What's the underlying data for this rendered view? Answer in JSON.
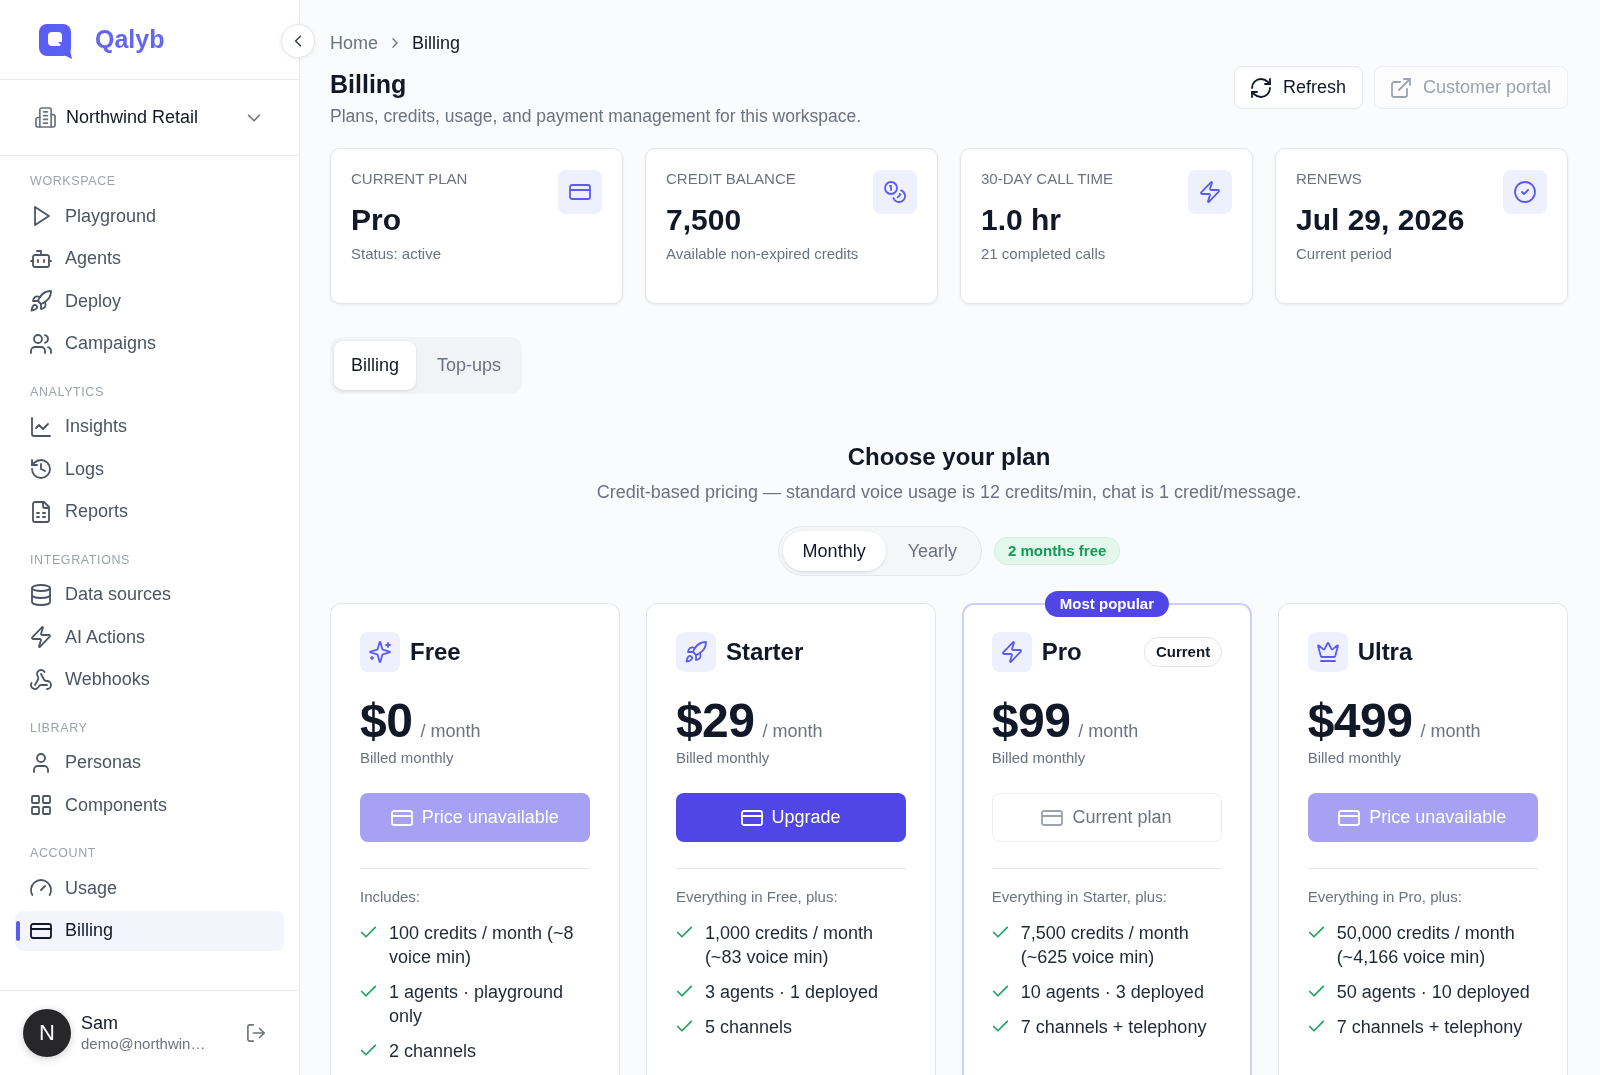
{
  "sidebar": {
    "brand": "Qalyb",
    "workspace": "Northwind Retail",
    "sections": [
      {
        "title": "WORKSPACE",
        "items": [
          {
            "label": "Playground",
            "selected": false
          },
          {
            "label": "Agents",
            "selected": false
          },
          {
            "label": "Deploy",
            "selected": false
          },
          {
            "label": "Campaigns",
            "selected": false
          }
        ]
      },
      {
        "title": "ANALYTICS",
        "items": [
          {
            "label": "Insights",
            "selected": false
          },
          {
            "label": "Logs",
            "selected": false
          },
          {
            "label": "Reports",
            "selected": false
          }
        ]
      },
      {
        "title": "INTEGRATIONS",
        "items": [
          {
            "label": "Data sources",
            "selected": false
          },
          {
            "label": "AI Actions",
            "selected": false
          },
          {
            "label": "Webhooks",
            "selected": false
          }
        ]
      },
      {
        "title": "LIBRARY",
        "items": [
          {
            "label": "Personas",
            "selected": false
          },
          {
            "label": "Components",
            "selected": false
          }
        ]
      },
      {
        "title": "ACCOUNT",
        "items": [
          {
            "label": "Usage",
            "selected": false
          },
          {
            "label": "Billing",
            "selected": true
          }
        ]
      }
    ],
    "user": {
      "initial": "N",
      "name": "Sam",
      "email": "demo@northwin…"
    }
  },
  "breadcrumb": [
    {
      "label": "Home",
      "current": false
    },
    {
      "label": "Billing",
      "current": true
    }
  ],
  "header": {
    "title": "Billing",
    "subtitle": "Plans, credits, usage, and payment management for this workspace.",
    "actions": [
      {
        "label": "Refresh",
        "disabled": false
      },
      {
        "label": "Customer portal",
        "disabled": true
      }
    ]
  },
  "stats": [
    {
      "label": "CURRENT PLAN",
      "value": "Pro",
      "caption": "Status: active"
    },
    {
      "label": "CREDIT BALANCE",
      "value": "7,500",
      "caption": "Available non-expired credits"
    },
    {
      "label": "30-DAY CALL TIME",
      "value": "1.0 hr",
      "caption": "21 completed calls"
    },
    {
      "label": "RENEWS",
      "value": "Jul 29, 2026",
      "caption": "Current period"
    }
  ],
  "tabs": [
    {
      "label": "Billing",
      "selected": true
    },
    {
      "label": "Top-ups",
      "selected": false
    }
  ],
  "plans_section": {
    "title": "Choose your plan",
    "subtitle": "Credit-based pricing — standard voice usage is 12 credits/min, chat is 1 credit/message.",
    "billing_period": [
      {
        "label": "Monthly",
        "selected": true
      },
      {
        "label": "Yearly",
        "selected": false
      }
    ],
    "promo_badge": "2 months free",
    "plans": [
      {
        "name": "Free",
        "highlighted": false,
        "price": "$0",
        "period": "/ month",
        "billing_note": "Billed monthly",
        "button": {
          "label": "Price unavailable",
          "kind": "unavailable"
        },
        "features_title": "Includes:",
        "features": [
          "100 credits / month (~8 voice min)",
          "1 agents · playground only",
          "2 channels"
        ]
      },
      {
        "name": "Starter",
        "highlighted": false,
        "price": "$29",
        "period": "/ month",
        "billing_note": "Billed monthly",
        "button": {
          "label": "Upgrade",
          "kind": "primary"
        },
        "features_title": "Everything in Free, plus:",
        "features": [
          "1,000 credits / month (~83 voice min)",
          "3 agents · 1 deployed",
          "5 channels"
        ]
      },
      {
        "name": "Pro",
        "highlighted": true,
        "ribbon": "Most popular",
        "tag": "Current",
        "price": "$99",
        "period": "/ month",
        "billing_note": "Billed monthly",
        "button": {
          "label": "Current plan",
          "kind": "current"
        },
        "features_title": "Everything in Starter, plus:",
        "features": [
          "7,500 credits / month (~625 voice min)",
          "10 agents · 3 deployed",
          "7 channels + telephony"
        ]
      },
      {
        "name": "Ultra",
        "highlighted": false,
        "price": "$499",
        "period": "/ month",
        "billing_note": "Billed monthly",
        "button": {
          "label": "Price unavailable",
          "kind": "unavailable"
        },
        "features_title": "Everything in Pro, plus:",
        "features": [
          "50,000 credits / month (~4,166 voice min)",
          "50 agents · 10 deployed",
          "7 channels + telephony"
        ]
      }
    ]
  }
}
